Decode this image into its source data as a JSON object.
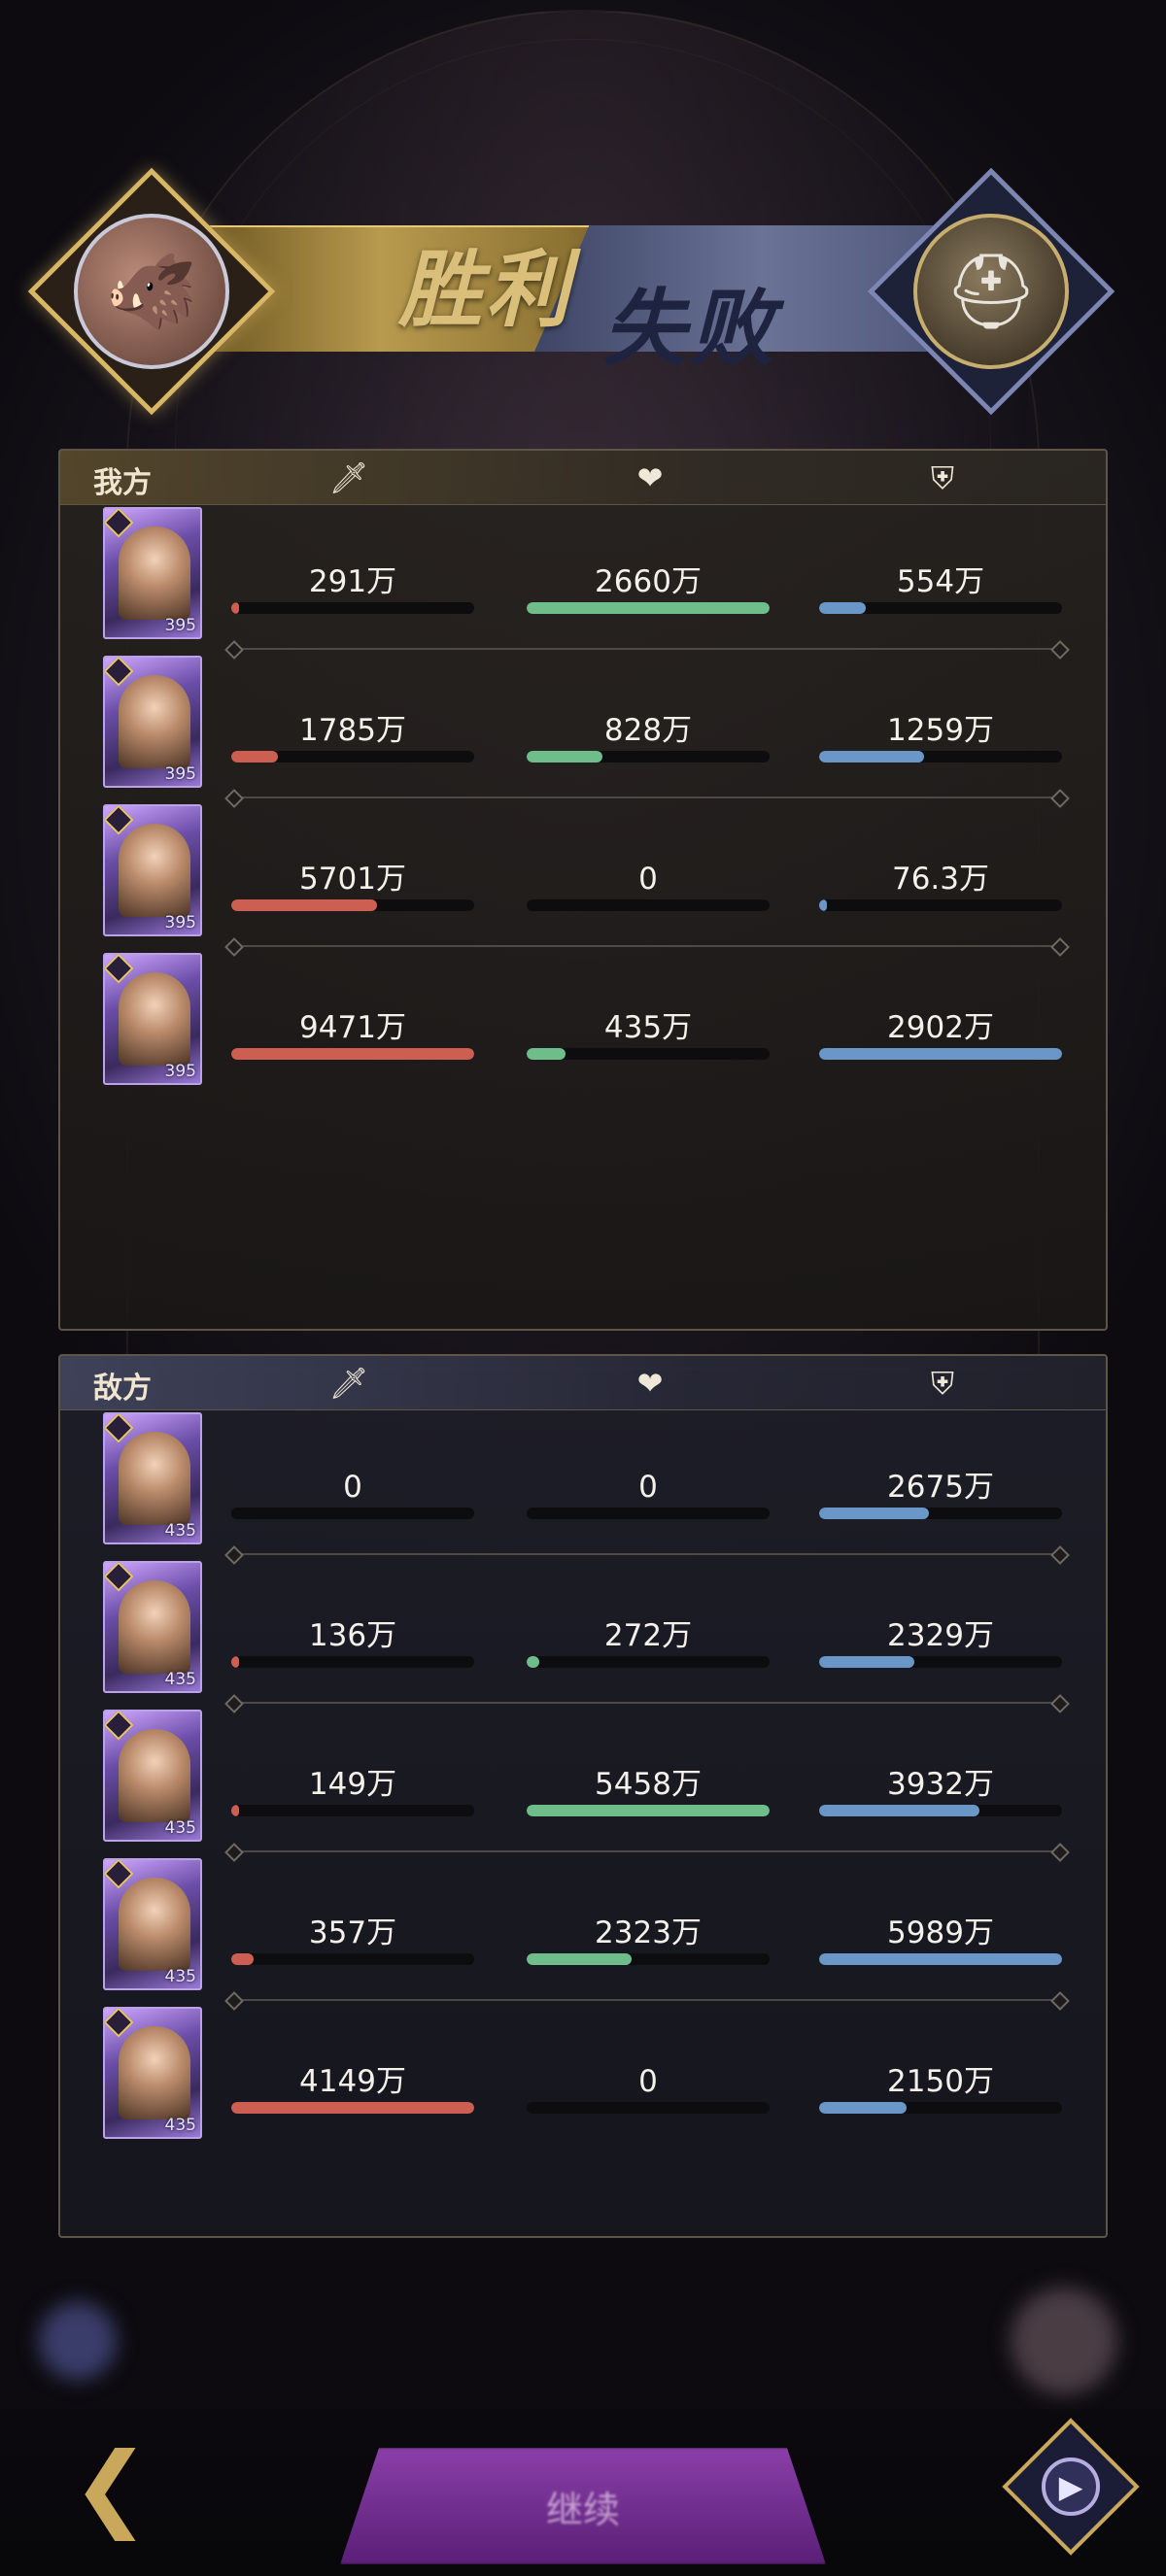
{
  "banner": {
    "win_text": "胜利",
    "lose_text": "失败",
    "left_avatar_icon": "boar-head-avatar",
    "right_avatar_icon": "armored-helmet-avatar"
  },
  "our_side": {
    "label": "我方",
    "columns": [
      "attack-icon",
      "heart-icon",
      "shield-icon"
    ],
    "heroes": [
      {
        "level": "395",
        "attack": "291万",
        "heal": "2660万",
        "defense": "554万",
        "attack_pct": 3,
        "heal_pct": 100,
        "defense_pct": 19
      },
      {
        "level": "395",
        "attack": "1785万",
        "heal": "828万",
        "defense": "1259万",
        "attack_pct": 19,
        "heal_pct": 31,
        "defense_pct": 43
      },
      {
        "level": "395",
        "attack": "5701万",
        "heal": "0",
        "defense": "76.3万",
        "attack_pct": 60,
        "heal_pct": 0,
        "defense_pct": 3
      },
      {
        "level": "395",
        "attack": "9471万",
        "heal": "435万",
        "defense": "2902万",
        "attack_pct": 100,
        "heal_pct": 16,
        "defense_pct": 100
      }
    ]
  },
  "enemy_side": {
    "label": "敌方",
    "columns": [
      "attack-icon",
      "heart-icon",
      "shield-icon"
    ],
    "heroes": [
      {
        "level": "435",
        "attack": "0",
        "heal": "0",
        "defense": "2675万",
        "attack_pct": 0,
        "heal_pct": 0,
        "defense_pct": 45
      },
      {
        "level": "435",
        "attack": "136万",
        "heal": "272万",
        "defense": "2329万",
        "attack_pct": 3,
        "heal_pct": 5,
        "defense_pct": 39
      },
      {
        "level": "435",
        "attack": "149万",
        "heal": "5458万",
        "defense": "3932万",
        "attack_pct": 3,
        "heal_pct": 100,
        "defense_pct": 66
      },
      {
        "level": "435",
        "attack": "357万",
        "heal": "2323万",
        "defense": "5989万",
        "attack_pct": 9,
        "heal_pct": 43,
        "defense_pct": 100
      },
      {
        "level": "435",
        "attack": "4149万",
        "heal": "0",
        "defense": "2150万",
        "attack_pct": 100,
        "heal_pct": 0,
        "defense_pct": 36
      }
    ]
  },
  "bottom": {
    "main_button": "继续",
    "back_icon": "back-arrow-icon",
    "replay_icon": "replay-icon"
  },
  "colors": {
    "attack": "#cc5f52",
    "heal": "#6fbd8a",
    "defense": "#6a96c8",
    "gold": "#d7b765"
  }
}
